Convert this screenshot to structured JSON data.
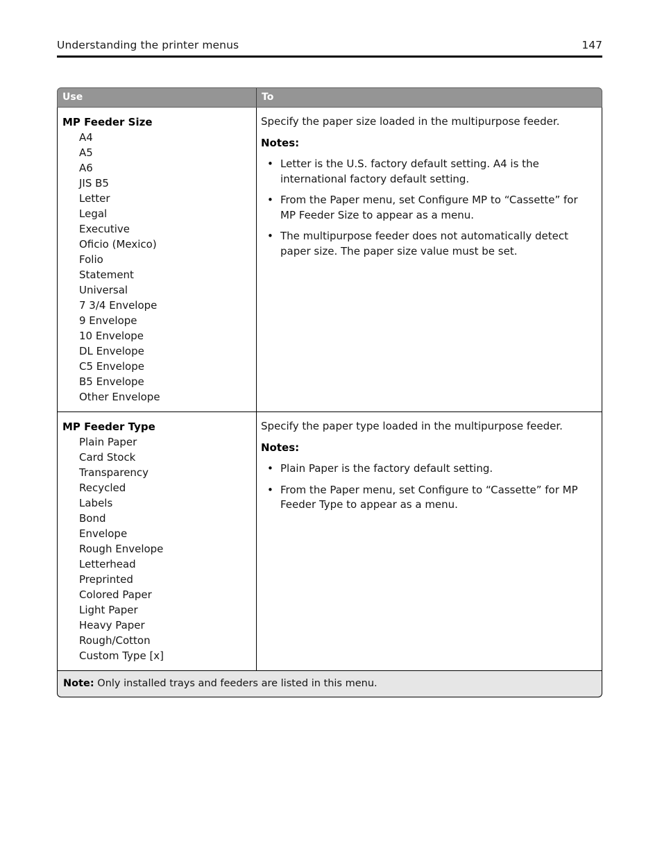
{
  "page": {
    "header_title": "Understanding the printer menus",
    "page_number": "147"
  },
  "table": {
    "columns": {
      "use": "Use",
      "to": "To"
    },
    "rows": [
      {
        "setting_name": "MP Feeder Size",
        "options": [
          "A4",
          "A5",
          "A6",
          "JIS B5",
          "Letter",
          "Legal",
          "Executive",
          "Oficio (Mexico)",
          "Folio",
          "Statement",
          "Universal",
          "7 3/4 Envelope",
          "9 Envelope",
          "10 Envelope",
          "DL Envelope",
          "C5 Envelope",
          "B5 Envelope",
          "Other Envelope"
        ],
        "description": "Specify the paper size loaded in the multipurpose feeder.",
        "notes_label": "Notes:",
        "notes": [
          "Letter is the U.S. factory default setting. A4 is the international factory default setting.",
          "From the Paper menu, set Configure MP to “Cassette” for MP Feeder Size to appear as a menu.",
          "The multipurpose feeder does not automatically detect paper size. The paper size value must be set."
        ]
      },
      {
        "setting_name": "MP Feeder Type",
        "options": [
          "Plain Paper",
          "Card Stock",
          "Transparency",
          "Recycled",
          "Labels",
          "Bond",
          "Envelope",
          "Rough Envelope",
          "Letterhead",
          "Preprinted",
          "Colored Paper",
          "Light Paper",
          "Heavy Paper",
          "Rough/Cotton",
          "Custom Type [x]"
        ],
        "description": "Specify the paper type loaded in the multipurpose feeder.",
        "notes_label": "Notes:",
        "notes": [
          "Plain Paper is the factory default setting.",
          "From the Paper menu, set Configure to “Cassette” for MP Feeder Type to appear as a menu."
        ]
      }
    ],
    "footer_note": {
      "label": "Note:",
      "text": " Only installed trays and feeders are listed in this menu."
    }
  },
  "colors": {
    "header_fill": "#959595",
    "footer_fill": "#e6e6e6",
    "rule": "#000000",
    "text": "#161616"
  },
  "bullet_glyph": "•"
}
